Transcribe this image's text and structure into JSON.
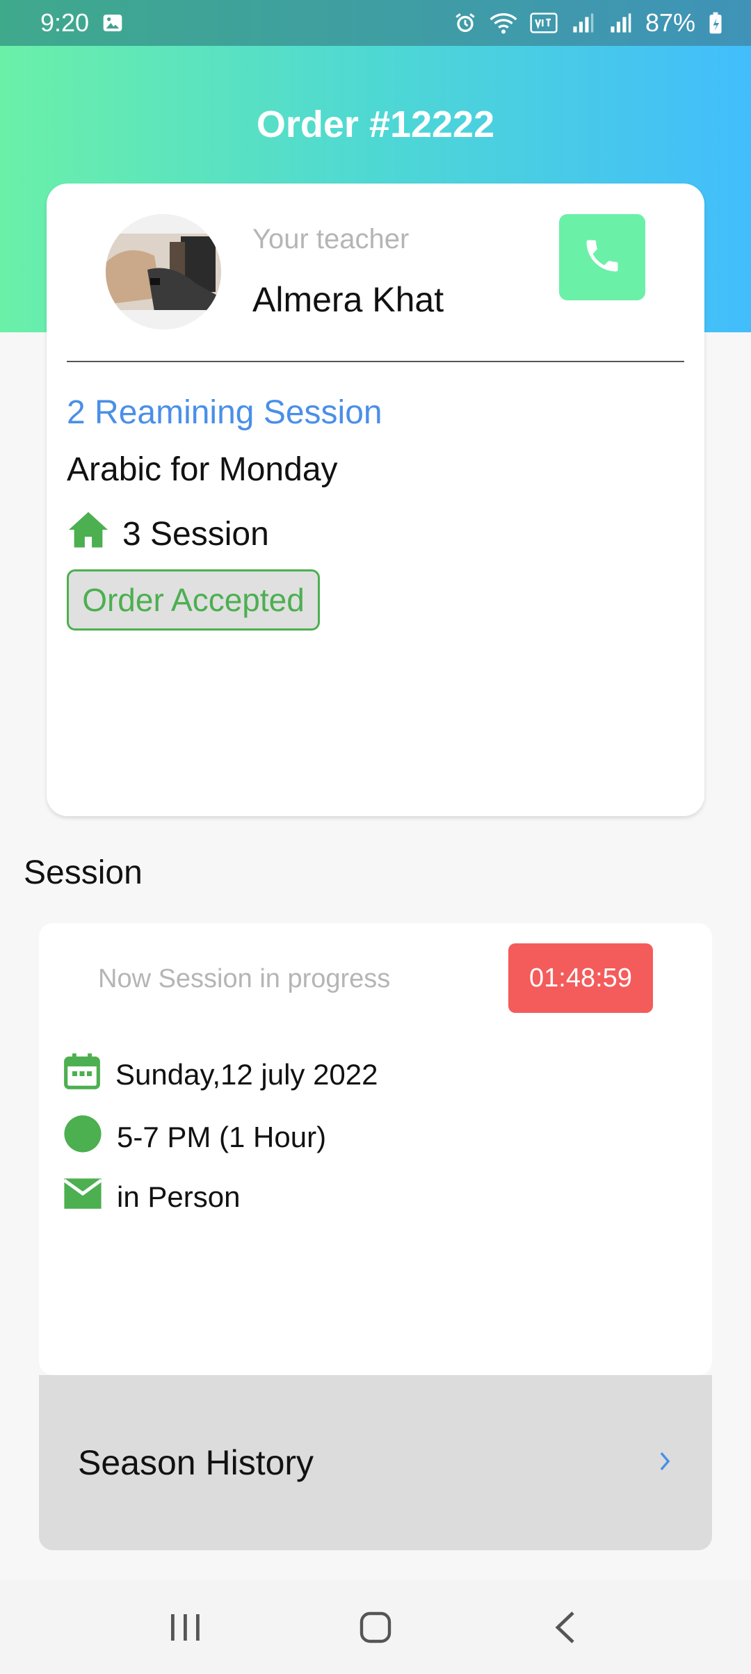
{
  "status_bar": {
    "time": "9:20",
    "battery": "87%"
  },
  "header": {
    "title": "Order #12222"
  },
  "teacher_card": {
    "caption": "Your teacher",
    "name": "Almera Khat",
    "remaining_sessions": "2 Reamining Session",
    "course": "Arabic for Monday",
    "session_count": "3 Session",
    "status": "Order Accepted"
  },
  "session_section": {
    "title": "Session",
    "progress_text": "Now Session in progress",
    "timer": "01:48:59",
    "date": "Sunday,12 july 2022",
    "time_range": "5-7 PM (1 Hour)",
    "mode": "in Person"
  },
  "history": {
    "label": "Season History"
  },
  "colors": {
    "accent_green": "#4caf50",
    "mint": "#6bf0a8",
    "blue_text": "#4a8fe8",
    "timer_red": "#f45b5b"
  }
}
